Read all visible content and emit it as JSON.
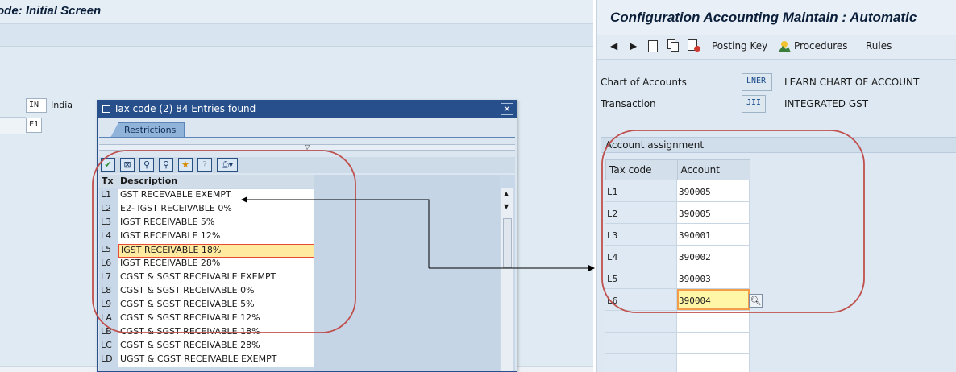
{
  "left_screen": {
    "title": "ode: Initial Screen",
    "country_code": "IN",
    "country_name": "India",
    "second_field": "F1"
  },
  "dialog": {
    "title": "Tax code (2)   84 Entries found",
    "tab_label": "Restrictions",
    "header_tx": "Tx",
    "header_description": "Description",
    "icons": [
      "check-icon",
      "cancel-icon",
      "find-icon",
      "find-next-icon",
      "favorite-add-icon",
      "help-icon",
      "print-icon"
    ],
    "rows": [
      {
        "tx": "L1",
        "description": "GST RECEVABLE EXEMPT"
      },
      {
        "tx": "L2",
        "description": "E2- IGST RECEIVABLE 0%"
      },
      {
        "tx": "L3",
        "description": "IGST RECEIVABLE 5%"
      },
      {
        "tx": "L4",
        "description": "IGST RECEIVABLE 12%"
      },
      {
        "tx": "L5",
        "description": "IGST RECEIVABLE 18%",
        "selected": true
      },
      {
        "tx": "L6",
        "description": "IGST RECEIVABLE 28%"
      },
      {
        "tx": "L7",
        "description": "CGST & SGST RECEIVABLE EXEMPT"
      },
      {
        "tx": "L8",
        "description": "CGST & SGST RECEIVABLE 0%"
      },
      {
        "tx": "L9",
        "description": "CGST & SGST RECEIVABLE 5%"
      },
      {
        "tx": "LA",
        "description": "CGST & SGST RECEIVABLE 12%"
      },
      {
        "tx": "LB",
        "description": "CGST & SGST RECEIVABLE 18%"
      },
      {
        "tx": "LC",
        "description": "CGST & SGST RECEIVABLE 28%"
      },
      {
        "tx": "LD",
        "description": "UGST & CGST RECEIVABLE EXEMPT"
      }
    ]
  },
  "right_screen": {
    "title": "Configuration Accounting Maintain : Automatic",
    "toolbar": {
      "posting_key": "Posting Key",
      "procedures": "Procedures",
      "rules": "Rules"
    },
    "chart_of_accounts_label": "Chart of Accounts",
    "chart_of_accounts_value": "LNER",
    "chart_of_accounts_text": "LEARN CHART OF ACCOUNT",
    "transaction_label": "Transaction",
    "transaction_value": "JII",
    "transaction_text": "INTEGRATED GST",
    "section_title": "Account assignment",
    "table": {
      "col_taxcode": "Tax code",
      "col_account": "Account",
      "rows": [
        {
          "taxcode": "L1",
          "account": "390005"
        },
        {
          "taxcode": "L2",
          "account": "390005"
        },
        {
          "taxcode": "L3",
          "account": "390001"
        },
        {
          "taxcode": "L4",
          "account": "390002"
        },
        {
          "taxcode": "L5",
          "account": "390003"
        },
        {
          "taxcode": "L6",
          "account": "390004",
          "selected": true
        }
      ]
    }
  },
  "colors": {
    "dialog_caption": "#264f8b",
    "selection_border": "#e84a36",
    "selection_fill": "#ffeaa0",
    "annotation": "#c0504d"
  }
}
